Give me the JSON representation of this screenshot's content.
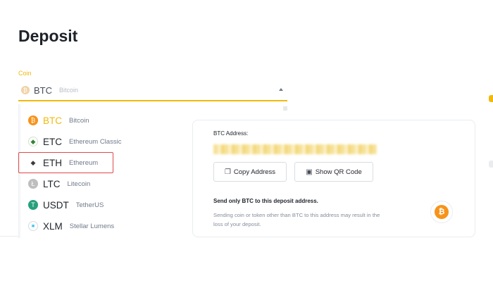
{
  "page": {
    "title": "Deposit"
  },
  "coin_field": {
    "label": "Coin",
    "selected_symbol": "BTC",
    "selected_name": "Bitcoin",
    "selected_icon": "₿"
  },
  "coin_list": [
    {
      "symbol": "BTC",
      "name": "Bitcoin",
      "icon": "₿",
      "icon_name": "bitcoin-icon"
    },
    {
      "symbol": "ETC",
      "name": "Ethereum Classic",
      "icon": "◆",
      "icon_name": "ethereum-classic-icon"
    },
    {
      "symbol": "ETH",
      "name": "Ethereum",
      "icon": "◆",
      "icon_name": "ethereum-icon"
    },
    {
      "symbol": "LTC",
      "name": "Litecoin",
      "icon": "Ł",
      "icon_name": "litecoin-icon"
    },
    {
      "symbol": "USDT",
      "name": "TetherUS",
      "icon": "T",
      "icon_name": "tether-icon"
    },
    {
      "symbol": "XLM",
      "name": "Stellar Lumens",
      "icon": "✶",
      "icon_name": "stellar-icon"
    }
  ],
  "address_card": {
    "label": "BTC Address:",
    "copy_button": "Copy Address",
    "copy_icon": "❐",
    "qr_button": "Show QR Code",
    "qr_icon": "▣",
    "warning_title": "Send only BTC to this deposit address.",
    "warning_text": "Sending coin or token other than BTC to this address may result in the loss of your deposit.",
    "badge_icon": "₿"
  },
  "colors": {
    "accent": "#f0b90b",
    "highlight_border": "#e04a4a",
    "text_primary": "#1e2329",
    "text_secondary": "#707a8a"
  }
}
